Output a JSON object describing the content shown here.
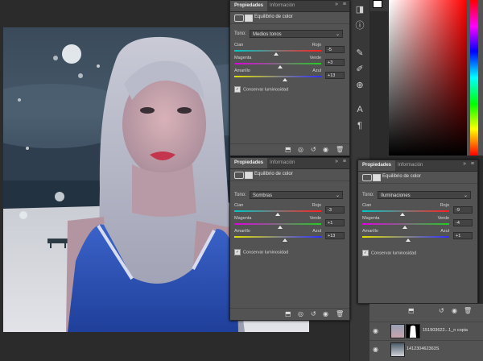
{
  "panels": {
    "top": {
      "tab_active": "Propiedades",
      "tab_inactive": "Información",
      "title": "Equilibrio de color",
      "tone_label": "Tono:",
      "tone_value": "Medios tonos",
      "sliders": [
        {
          "left": "Cian",
          "right": "Rojo",
          "value": "-5",
          "level": -5
        },
        {
          "left": "Magenta",
          "right": "Verde",
          "value": "+3",
          "level": 3
        },
        {
          "left": "Amarillo",
          "right": "Azul",
          "value": "+13",
          "level": 13
        }
      ],
      "preserve_label": "Conservar luminosidad"
    },
    "middle": {
      "tab_active": "Propiedades",
      "tab_inactive": "Información",
      "title": "Equilibrio de color",
      "tone_label": "Tono:",
      "tone_value": "Sombras",
      "sliders": [
        {
          "left": "Cian",
          "right": "Rojo",
          "value": "-3",
          "level": -3
        },
        {
          "left": "Magenta",
          "right": "Verde",
          "value": "+1",
          "level": 1
        },
        {
          "left": "Amarillo",
          "right": "Azul",
          "value": "+13",
          "level": 13
        }
      ],
      "preserve_label": "Conservar luminosidad"
    },
    "right": {
      "tab_active": "Propiedades",
      "tab_inactive": "Información",
      "title": "Equilibrio de color",
      "tone_label": "Tono:",
      "tone_value": "Iluminaciones",
      "sliders": [
        {
          "left": "Cian",
          "right": "Rojo",
          "value": "-9",
          "level": -9
        },
        {
          "left": "Magenta",
          "right": "Verde",
          "value": "-4",
          "level": -4
        },
        {
          "left": "Amarillo",
          "right": "Azul",
          "value": "+1",
          "level": 1
        }
      ],
      "preserve_label": "Conservar luminosidad"
    }
  },
  "layers": [
    {
      "name": "151903622...1_n copia"
    },
    {
      "name": "141230462363S"
    }
  ],
  "colors": {
    "panel_bg": "#535353",
    "cyan_red_track": [
      "#00c8c8",
      "#ff2020"
    ],
    "magenta_green_track": [
      "#e000e0",
      "#20d020"
    ],
    "yellow_blue_track": [
      "#e0e000",
      "#3030ff"
    ]
  }
}
